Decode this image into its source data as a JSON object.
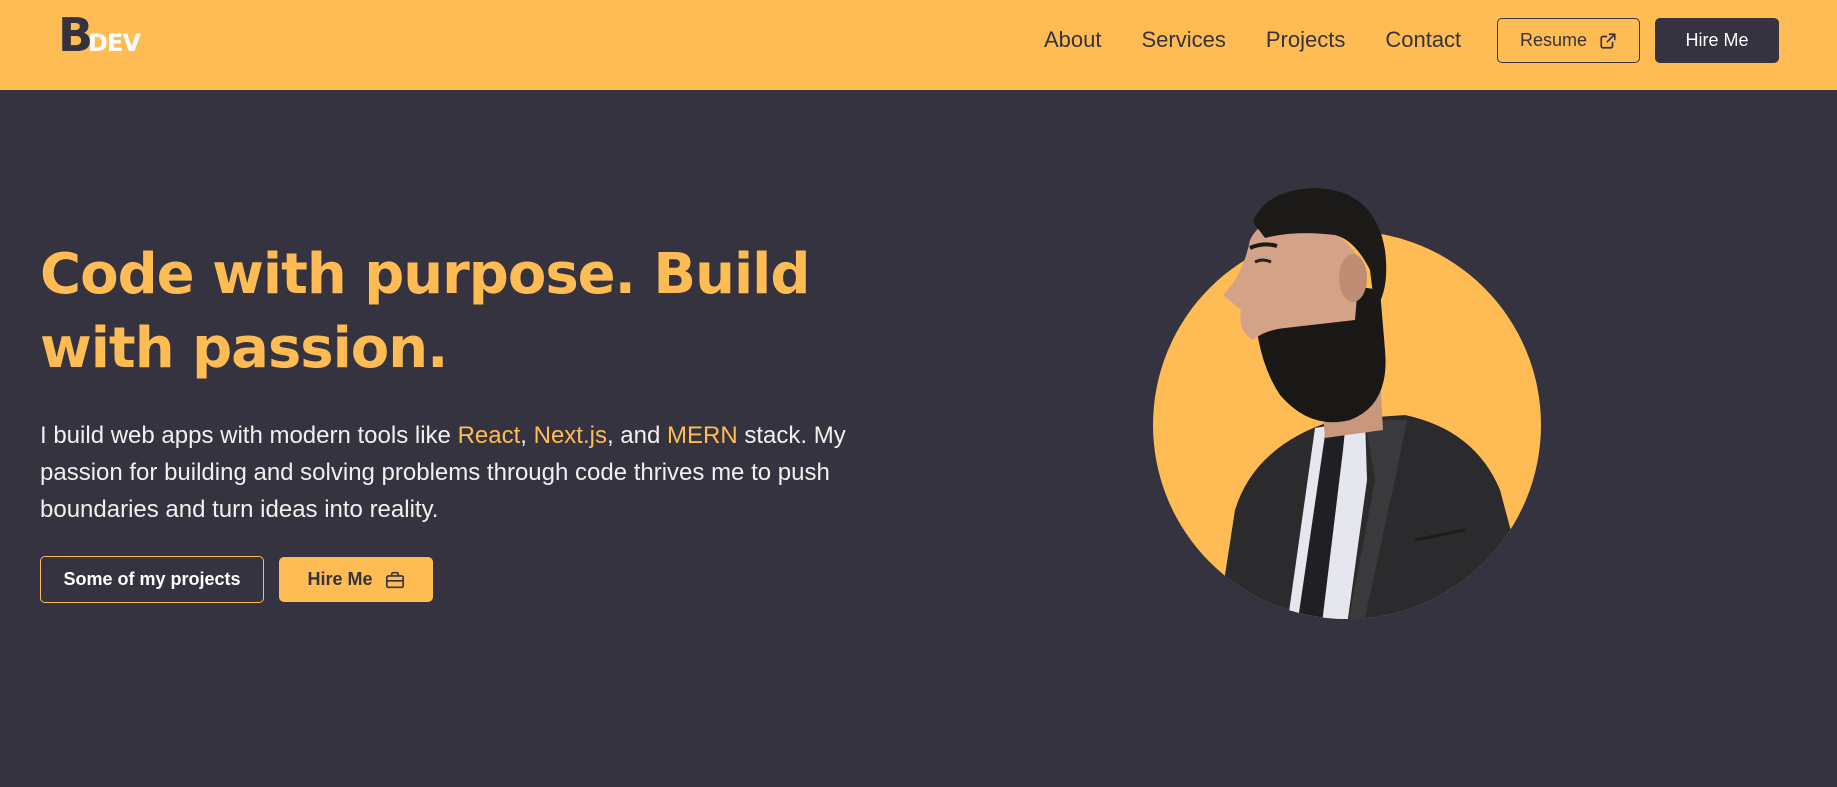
{
  "navbar": {
    "logo": {
      "letter": "B",
      "text": "DEV"
    },
    "links": [
      "About",
      "Services",
      "Projects",
      "Contact"
    ],
    "resume_label": "Resume",
    "resume_icon": "external-link-icon",
    "hire_label": "Hire Me"
  },
  "hero": {
    "title": "Code with purpose. Build with passion.",
    "description": {
      "prefix": "I build web apps with modern tools like ",
      "tech1": "React",
      "sep1": ", ",
      "tech2": "Next.js",
      "sep2": ", and ",
      "tech3": "MERN",
      "suffix": " stack. My passion for building and solving problems through code thrives me to push boundaries and turn ideas into reality."
    },
    "projects_button": "Some of my projects",
    "hire_button": "Hire Me",
    "hire_icon": "briefcase-icon",
    "portrait_alt": "portrait-photo"
  },
  "colors": {
    "accent": "#ffbc55",
    "background": "#35333f",
    "text_light": "#f2f0ee"
  }
}
